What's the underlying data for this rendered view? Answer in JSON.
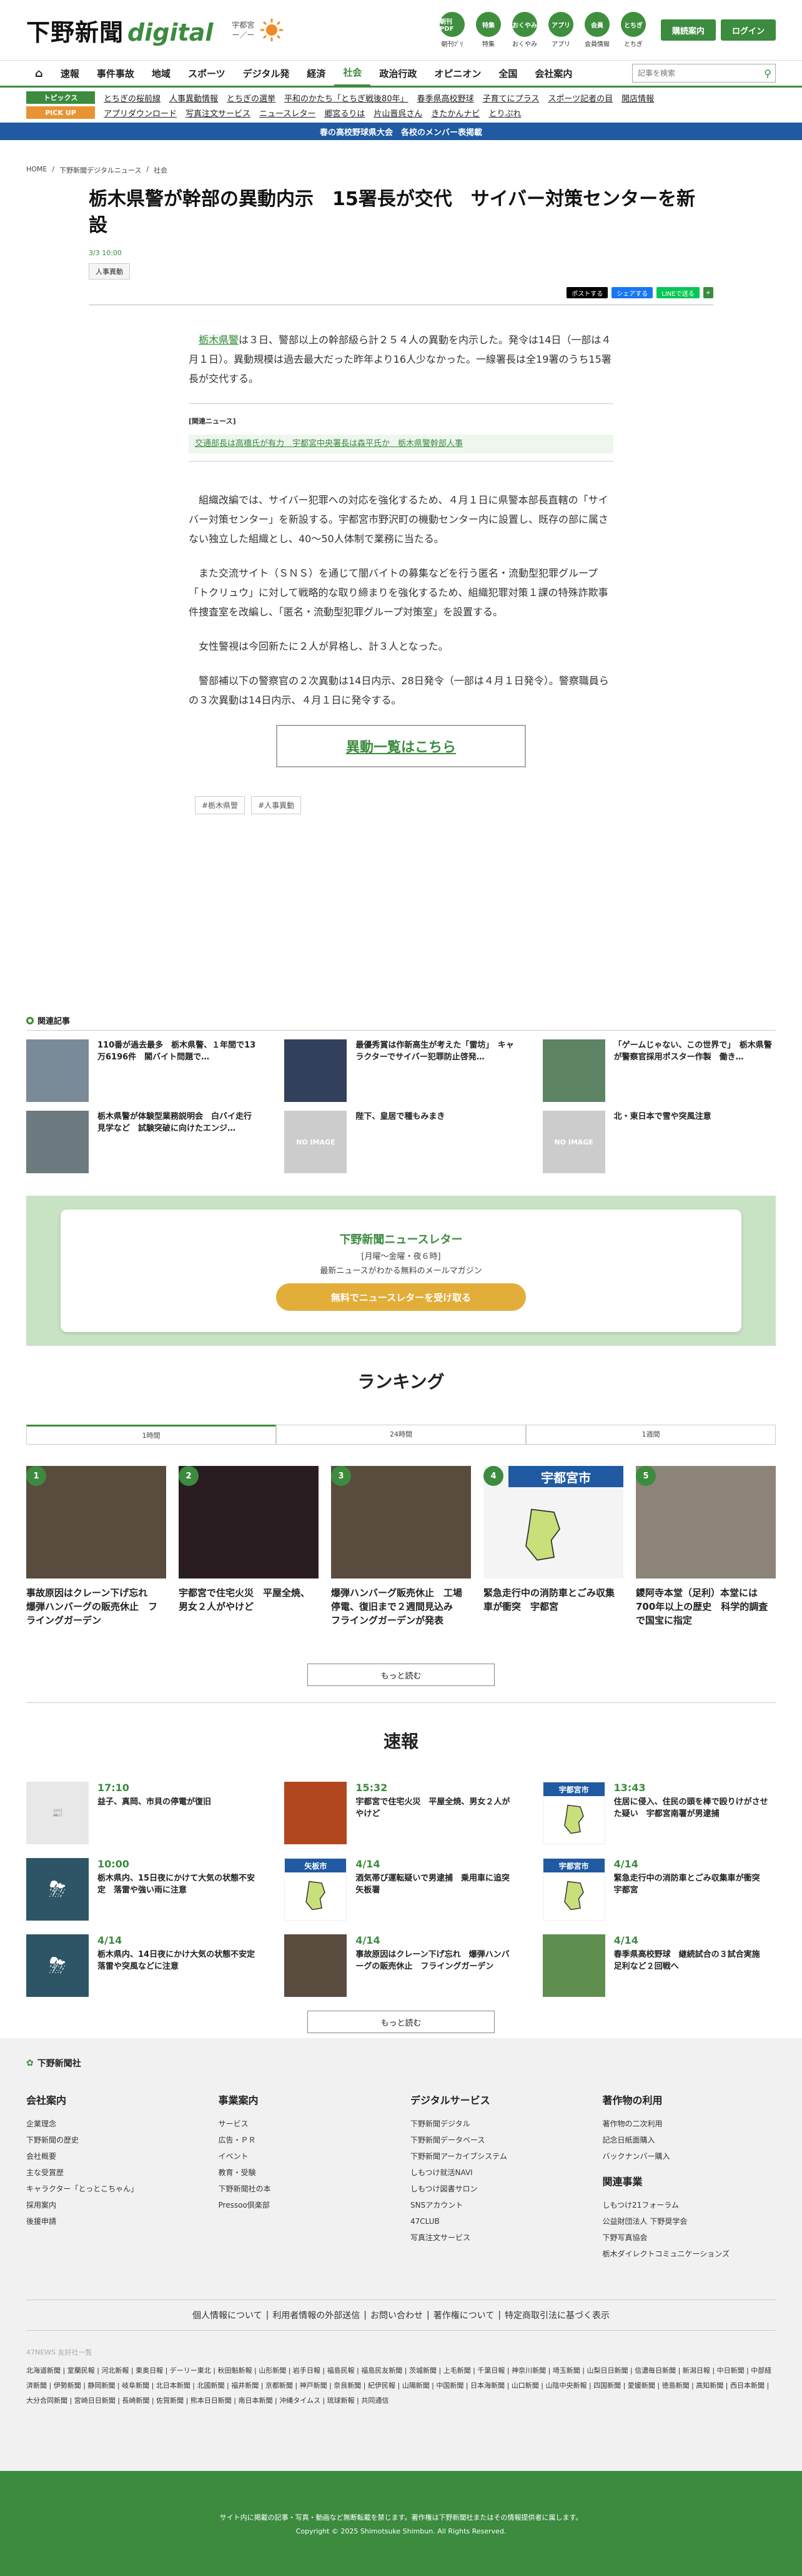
{
  "header": {
    "logo_ja": "下野新聞",
    "logo_digital": "digital",
    "weather_city": "宇都宮",
    "weather_temp": "ー／ー",
    "icons": [
      {
        "label": "朝刊PDF",
        "caption": "朝刊ﾌﾟﾘ"
      },
      {
        "label": "特集",
        "caption": "特集"
      },
      {
        "label": "おくやみ",
        "caption": "おくやみ"
      },
      {
        "label": "アプリ",
        "caption": "アプリ"
      },
      {
        "label": "会員",
        "caption": "会員情報"
      },
      {
        "label": "とちぎ",
        "caption": "とちぎ"
      }
    ],
    "subscribe": "購読案内",
    "login": "ログイン"
  },
  "nav": {
    "items": [
      "速報",
      "事件事故",
      "地域",
      "スポーツ",
      "デジタル発",
      "経済",
      "社会",
      "政治行政",
      "オピニオン",
      "全国",
      "会社案内"
    ],
    "active": "社会",
    "search_placeholder": "記事を検索"
  },
  "subnav": {
    "topics_label": "トピックス",
    "topics": [
      "とちぎの桜前線",
      "人事異動情報",
      "とちぎの選挙",
      "平和のかたち「とちぎ戦後80年」",
      "春季県高校野球",
      "子育てにプラス",
      "スポーツ記者の目",
      "開店情報"
    ],
    "pick_label": "PICK UP",
    "pick": [
      "アプリダウンロード",
      "写真注文サービス",
      "ニュースレター",
      "郷宮るりは",
      "片山晋呉さん",
      "きたかんナビ",
      "とりぷれ"
    ]
  },
  "banner": "春の高校野球県大会　各校のメンバー表掲載",
  "breadcrumb": [
    "HOME",
    "下野新聞デジタルニュース",
    "社会"
  ],
  "article": {
    "title": "栃木県警が幹部の異動内示　15署長が交代　サイバー対策センターを新設",
    "date": "3/3 10:00",
    "tag": "人事異動",
    "share": [
      "ポストする",
      "シェアする",
      "LINEで送る"
    ],
    "p1_link": "栃木県警",
    "p1": "は３日、警部以上の幹部級ら計２５４人の異動を内示した。発令は14日（一部は４月１日）。異動規模は過去最大だった昨年より16人少なかった。一線署長は全19署のうち15署長が交代する。",
    "related_label": "[関連ニュース]",
    "related_link": "交通部長は高橋氏が有力　宇都宮中央署長は森平氏か　栃木県警幹部人事",
    "p2": "組織改編では、サイバー犯罪への対応を強化するため、４月１日に県警本部長直轄の「サイバー対策センター」を新設する。宇都宮市野沢町の機動センター内に設置し、既存の部に属さない独立した組織とし、40～50人体制で業務に当たる。",
    "p3": "また交流サイト（ＳＮＳ）を通じて闇バイトの募集などを行う匿名・流動型犯罪グループ「トクリュウ」に対して戦略的な取り締まりを強化するため、組織犯罪対策１課の特殊詐欺事件捜査室を改編し、「匿名・流動型犯罪グループ対策室」を設置する。",
    "p4": "女性警視は今回新たに２人が昇格し、計３人となった。",
    "p5": "警部補以下の警察官の２次異動は14日内示、28日発令（一部は４月１日発令）。警察職員らの３次異動は14日内示、４月１日に発令する。",
    "list_button": "異動一覧はこちら",
    "bottom_tags": [
      "#栃木県警",
      "#人事異動"
    ]
  },
  "related": {
    "heading": "関連記事",
    "items": [
      {
        "title": "110番が過去最多　栃木県警、１年間で13万6196件　閣バイト問題で…",
        "thumb": ""
      },
      {
        "title": "最優秀賞は作新高生が考えた「雷坊」　キャラクターでサイバー犯罪防止啓発…",
        "thumb": ""
      },
      {
        "title": "「ゲームじゃない、この世界で」　栃木県警が警察官採用ポスター作製　働き…",
        "thumb": ""
      },
      {
        "title": "栃木県警が体験型業務説明会　白バイ走行見学など　試験突破に向けたエンジ…",
        "thumb": ""
      },
      {
        "title": "陛下、皇居で種もみまき",
        "thumb": "NO IMAGE"
      },
      {
        "title": "北・東日本で雪や突風注意",
        "thumb": "NO IMAGE"
      }
    ]
  },
  "newsletter": {
    "title": "下野新聞ニュースレター",
    "schedule": "[月曜～金曜・夜６時]",
    "desc": "最新ニュースがわかる無料のメールマガジン",
    "button": "無料でニュースレターを受け取る"
  },
  "ranking": {
    "heading": "ランキング",
    "tabs": [
      "1時間",
      "24時間",
      "1週間"
    ],
    "items": [
      {
        "rank": "1",
        "title": "事故原因はクレーン下げ忘れ　爆弾ハンバーグの販売休止　フライングガーデン"
      },
      {
        "rank": "2",
        "title": "宇都宮で住宅火災　平屋全焼、男女２人がやけど"
      },
      {
        "rank": "3",
        "title": "爆弾ハンバーグ販売休止　工場停電、復旧まで２週間見込み　フライングガーデンが発表"
      },
      {
        "rank": "4",
        "title": "緊急走行中の消防車とごみ収集車が衝突　宇都宮",
        "badge": "宇都宮市"
      },
      {
        "rank": "5",
        "title": "鑁阿寺本堂（足利）本堂には700年以上の歴史　科学的調査で国宝に指定"
      }
    ],
    "more": "もっと読む"
  },
  "speed": {
    "heading": "速報",
    "items": [
      {
        "time": "17:10",
        "title": "益子、真岡、市貝の停電が復旧",
        "badge": ""
      },
      {
        "time": "15:32",
        "title": "宇都宮で住宅火災　平屋全焼、男女２人がやけど",
        "badge": ""
      },
      {
        "time": "13:43",
        "title": "住居に侵入、住民の頭を棒で殴りけがさせた疑い　宇都宮南署が男逮捕",
        "badge": "宇都宮市"
      },
      {
        "time": "10:00",
        "title": "栃木県内、15日夜にかけて大気の状態不安定　落雷や強い雨に注意",
        "badge": ""
      },
      {
        "time": "4/14",
        "title": "酒気帯び運転疑いで男逮捕　乗用車に追突　矢板署",
        "badge": "矢板市"
      },
      {
        "time": "4/14",
        "title": "緊急走行中の消防車とごみ収集車が衝突　宇都宮",
        "badge": "宇都宮市"
      },
      {
        "time": "4/14",
        "title": "栃木県内、14日夜にかけ大気の状態不安定　落雷や突風などに注意",
        "badge": ""
      },
      {
        "time": "4/14",
        "title": "事故原因はクレーン下げ忘れ　爆弾ハンバーグの販売休止　フライングガーデン",
        "badge": ""
      },
      {
        "time": "4/14",
        "title": "春季県高校野球　継続試合の３試合実施　足利など２回戦へ",
        "badge": ""
      }
    ],
    "more": "もっと読む"
  },
  "footer": {
    "logo": "下野新聞社",
    "cols": [
      {
        "h": "会社案内",
        "links": [
          "企業理念",
          "下野新聞の歴史",
          "会社概要",
          "主な受賞歴",
          "キャラクター「とっとこちゃん」",
          "採用案内",
          "後援申請"
        ]
      },
      {
        "h": "事業案内",
        "links": [
          "サービス",
          "広告・ＰＲ",
          "イベント",
          "教育・受験",
          "下野新聞社の本",
          "Pressoo倶楽部"
        ]
      },
      {
        "h": "デジタルサービス",
        "links": [
          "下野新聞デジタル",
          "下野新聞データベース",
          "下野新聞アーカイブシステム",
          "しもつけ就活NAVI",
          "しもつけ図書サロン",
          "SNSアカウント",
          "47CLUB",
          "写真注文サービス"
        ]
      },
      {
        "h": "著作物の利用",
        "links": [
          "著作物の二次利用",
          "記念日紙面購入",
          "バックナンバー購入"
        ],
        "h2": "関連事業",
        "links2": [
          "しもつけ21フォーラム",
          "公益財団法人 下野奨学会",
          "下野写真協会",
          "栃木ダイレクトコミュニケーションズ"
        ]
      }
    ],
    "links": [
      "個人情報について",
      "利用者情報の外部送信",
      "お問い合わせ",
      "著作権について",
      "特定商取引法に基づく表示"
    ],
    "net_label": "47NEWS 友好社一覧",
    "papers": "北海道新聞 | 室蘭民報 | 河北新報 | 東奥日報 | デーリー東北 | 秋田魁新報 | 山形新聞 | 岩手日報 | 福島民報 | 福島民友新聞 | 茨城新聞 | 上毛新聞 | 千葉日報 | 神奈川新聞 | 埼玉新聞 | 山梨日日新聞 | 信濃毎日新聞 | 新潟日報 | 中日新聞 | 中部経済新聞 | 伊勢新聞 | 静岡新聞 | 岐阜新聞 | 北日本新聞 | 北國新聞 | 福井新聞 | 京都新聞 | 神戸新聞 | 奈良新聞 | 紀伊民報 | 山陽新聞 | 中国新聞 | 日本海新聞 | 山口新聞 | 山陰中央新報 | 四国新聞 | 愛媛新聞 | 徳島新聞 | 高知新聞 | 西日本新聞 | 大分合同新聞 | 宮崎日日新聞 | 長崎新聞 | 佐賀新聞 | 熊本日日新聞 | 南日本新聞 | 沖縄タイムス | 琉球新報 | 共同通信",
    "notice": "サイト内に掲載の記事・写真・動画など無断転載を禁じます。著作権は下野新聞社またはその情報提供者に属します。",
    "copyright": "Copyright © 2025 Shimotsuke Shimbun. All Rights Reserved."
  },
  "colors": {
    "accent": "#3c8b3f",
    "banner": "#1f5aa3",
    "cta": "#e3ad3a"
  }
}
